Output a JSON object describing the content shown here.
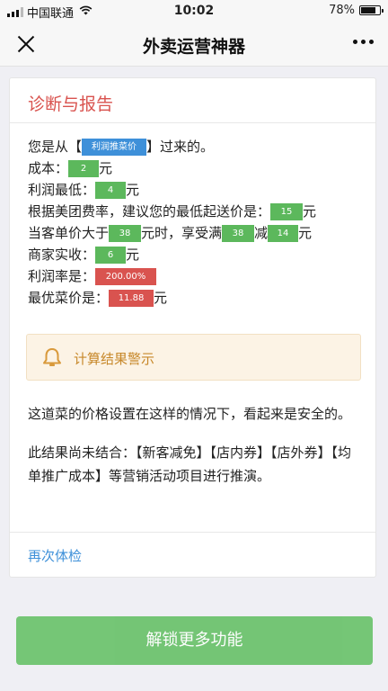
{
  "status_bar": {
    "carrier": "中国联通",
    "time": "10:02",
    "battery": "78%",
    "battery_level": 0.78
  },
  "nav": {
    "title": "外卖运营神器"
  },
  "card": {
    "title": "诊断与报告",
    "line1": {
      "prefix": "您是从【",
      "tag": "利润推菜价",
      "suffix": "】过来的。"
    },
    "line2": {
      "prefix": "成本：",
      "tag": "2",
      "suffix": "元"
    },
    "line3": {
      "prefix": "利润最低：",
      "tag": "4",
      "suffix": "元"
    },
    "line4": {
      "prefix": "根据美团费率，建议您的最低起送价是：",
      "tag": "15",
      "suffix": "元"
    },
    "line5": {
      "prefix": "当客单价大于",
      "tag1": "38",
      "mid1": "元时，享受满",
      "tag2": "38",
      "mid2": "减",
      "tag3": "14",
      "suffix": "元"
    },
    "line6": {
      "prefix": "商家实收：",
      "tag": "6",
      "suffix": "元"
    },
    "line7": {
      "prefix": "利润率是：",
      "tag": "200.00%"
    },
    "line8": {
      "prefix": "最优菜价是：",
      "tag": "11.88",
      "suffix": "元"
    },
    "alert": "计算结果警示",
    "para1": "这道菜的价格设置在这样的情况下，看起来是安全的。",
    "para2": "此结果尚未结合：【新客减免】【店内券】【店外券】【均单推广成本】等营销活动项目进行推演。",
    "retest": "再次体检"
  },
  "unlock_button": "解锁更多功能",
  "colors": {
    "green": "#5cb85c",
    "red": "#d9534f",
    "blue": "#3e90d9",
    "warning": "#c7882a"
  },
  "icons": {
    "close": "close-icon",
    "more": "more-icon",
    "alert": "bell-icon",
    "wifi": "wifi-icon",
    "battery": "battery-icon",
    "signal": "signal-icon"
  }
}
